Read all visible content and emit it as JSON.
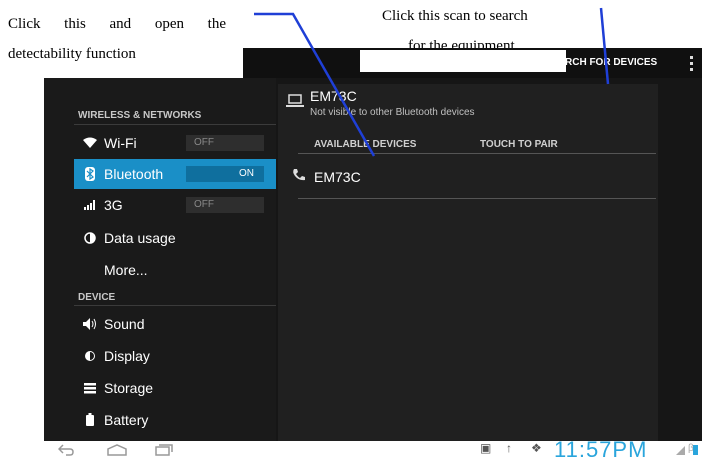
{
  "annotations": {
    "left_line1": "Click this and open the",
    "left_line2": "detectability function",
    "right_line1": "Click this scan to search",
    "right_line2": "for the equipment"
  },
  "action_bar": {
    "scan_button": "RCH FOR DEVICES",
    "overflow_icon": "overflow-menu-icon"
  },
  "sidebar": {
    "section_wireless": "WIRELESS & NETWORKS",
    "section_device": "DEVICE",
    "items": [
      {
        "label": "Wi-Fi",
        "icon": "wifi-icon",
        "toggle": "OFF"
      },
      {
        "label": "Bluetooth",
        "icon": "bluetooth-icon",
        "toggle": "ON",
        "active": true
      },
      {
        "label": "3G",
        "icon": "signal-icon",
        "toggle": "OFF"
      },
      {
        "label": "Data usage",
        "icon": "data-usage-icon"
      },
      {
        "label": "More..."
      },
      {
        "label": "Sound",
        "icon": "speaker-icon"
      },
      {
        "label": "Display",
        "icon": "display-icon"
      },
      {
        "label": "Storage",
        "icon": "storage-icon"
      },
      {
        "label": "Battery",
        "icon": "battery-icon"
      }
    ]
  },
  "main": {
    "device_name": "EM73C",
    "device_status": "Not visible to other Bluetooth devices",
    "available_header": "AVAILABLE DEVICES",
    "touch_header": "TOUCH TO PAIR",
    "available_devices": [
      {
        "name": "EM73C",
        "icon": "phone-icon"
      }
    ]
  },
  "status_bar": {
    "clock": "11:57PM"
  },
  "colors": {
    "accent": "#1a8fc7",
    "annotation_line": "#1f3fd6",
    "clock": "#2aa5dc"
  }
}
